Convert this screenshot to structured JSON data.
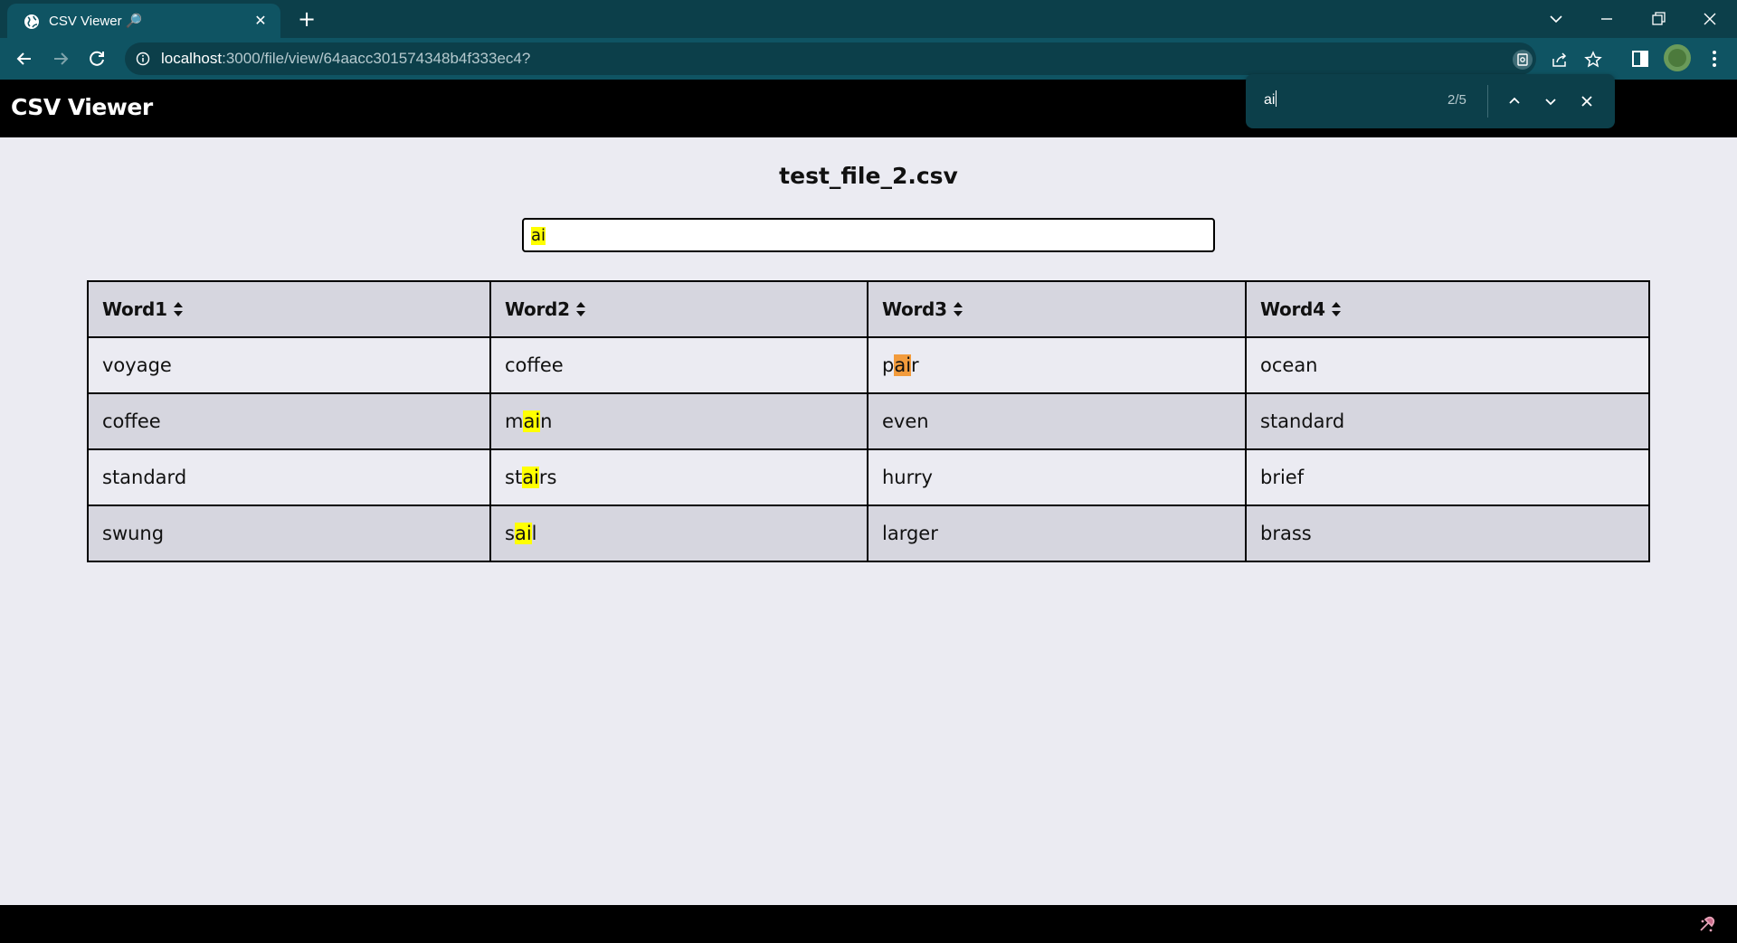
{
  "browser": {
    "tab": {
      "title": "CSV Viewer 🔎",
      "favicon": "globe-icon",
      "close_icon": "close-icon"
    },
    "new_tab_icon": "plus-icon",
    "window_controls": [
      "chevron-down-icon",
      "minimize-icon",
      "restore-icon",
      "close-icon"
    ],
    "url": {
      "host": "localhost",
      "rest": ":3000/file/view/64aacc301574348b4f333ec4?"
    },
    "colors": {
      "tabstrip": "#0c3f4a",
      "toolbar": "#0f5463"
    }
  },
  "find_bar": {
    "query": "ai",
    "count": "2/5",
    "buttons": [
      "chevron-up-icon",
      "chevron-down-icon",
      "close-icon"
    ]
  },
  "app": {
    "brand": "CSV Viewer",
    "file_title": "test_file_2.csv",
    "search": {
      "value": "ai"
    },
    "table": {
      "headers": [
        "Word1",
        "Word2",
        "Word3",
        "Word4"
      ],
      "rows": [
        [
          "voyage",
          "coffee",
          "pair",
          "ocean"
        ],
        [
          "coffee",
          "main",
          "even",
          "standard"
        ],
        [
          "standard",
          "stairs",
          "hurry",
          "brief"
        ],
        [
          "swung",
          "sail",
          "larger",
          "brass"
        ]
      ]
    },
    "colors": {
      "highlight": "#ffff00",
      "active_highlight": "#f29b3c",
      "header_bg": "#d6d6df",
      "page_bg": "#ebebf2"
    }
  }
}
